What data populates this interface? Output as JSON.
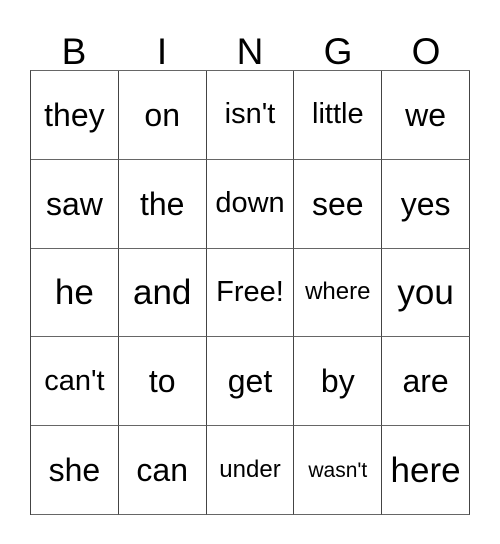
{
  "card": {
    "headers": [
      "B",
      "I",
      "N",
      "G",
      "O"
    ],
    "rows": [
      [
        {
          "word": "they",
          "size": "lg"
        },
        {
          "word": "on",
          "size": "lg"
        },
        {
          "word": "isn't",
          "size": "md"
        },
        {
          "word": "little",
          "size": "md"
        },
        {
          "word": "we",
          "size": "lg"
        }
      ],
      [
        {
          "word": "saw",
          "size": "lg"
        },
        {
          "word": "the",
          "size": "lg"
        },
        {
          "word": "down",
          "size": "md"
        },
        {
          "word": "see",
          "size": "lg"
        },
        {
          "word": "yes",
          "size": "lg"
        }
      ],
      [
        {
          "word": "he",
          "size": "xl"
        },
        {
          "word": "and",
          "size": "xl"
        },
        {
          "word": "Free!",
          "size": "md"
        },
        {
          "word": "where",
          "size": "sm"
        },
        {
          "word": "you",
          "size": "xl"
        }
      ],
      [
        {
          "word": "can't",
          "size": "md"
        },
        {
          "word": "to",
          "size": "lg"
        },
        {
          "word": "get",
          "size": "lg"
        },
        {
          "word": "by",
          "size": "lg"
        },
        {
          "word": "are",
          "size": "lg"
        }
      ],
      [
        {
          "word": "she",
          "size": "lg"
        },
        {
          "word": "can",
          "size": "lg"
        },
        {
          "word": "under",
          "size": "sm"
        },
        {
          "word": "wasn't",
          "size": "xs"
        },
        {
          "word": "here",
          "size": "xl"
        }
      ]
    ]
  },
  "colors": {
    "background": "#ffffff",
    "text": "#000000",
    "grid_line": "#444444",
    "grid_line_light": "#666666"
  }
}
